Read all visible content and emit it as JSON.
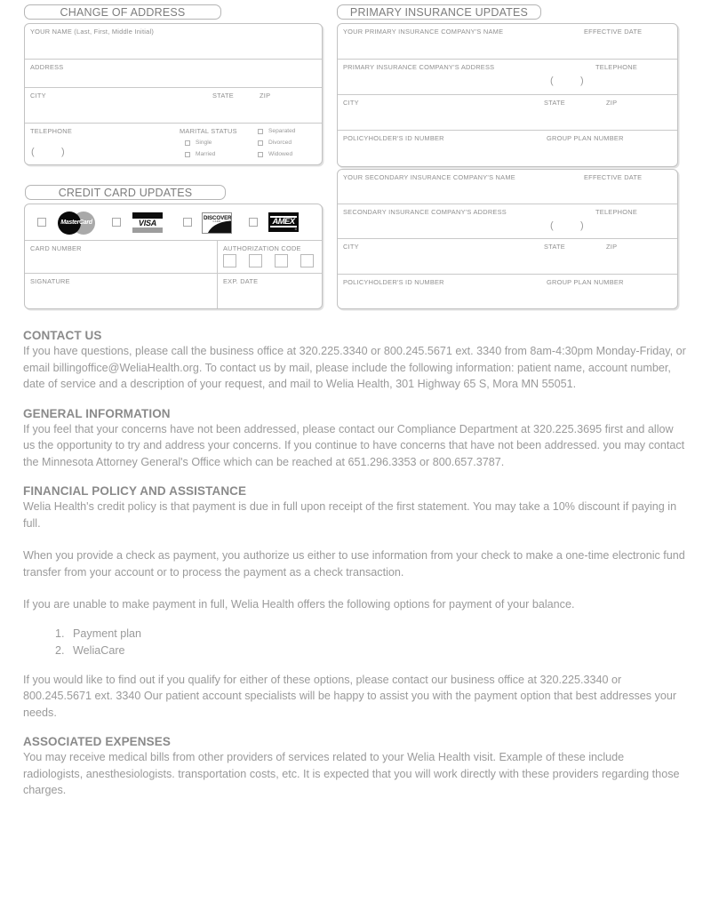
{
  "sections": {
    "change_of_address": {
      "title": "CHANGE OF ADDRESS",
      "fields": {
        "name": "YOUR NAME (Last, First, Middle Initial)",
        "address": "ADDRESS",
        "city": "CITY",
        "state": "STATE",
        "zip": "ZIP",
        "telephone": "TELEPHONE",
        "marital_status": "MARITAL STATUS",
        "phone_open": "(",
        "phone_close": ")"
      },
      "marital_options": [
        "Single",
        "Married",
        "Separated",
        "Divorced",
        "Widowed"
      ]
    },
    "credit_card_updates": {
      "title": "CREDIT CARD UPDATES",
      "cards": [
        {
          "name": "MasterCard",
          "label": "MasterCard"
        },
        {
          "name": "Visa",
          "label": "VISA"
        },
        {
          "name": "Discover",
          "label": "DISCOVER",
          "sub": "CARD"
        },
        {
          "name": "Amex",
          "label": "AMEX",
          "reg": "®"
        }
      ],
      "fields": {
        "card_number": "CARD NUMBER",
        "authorization_code": "AUTHORIZATION CODE",
        "signature": "SIGNATURE",
        "exp_date": "EXP. DATE"
      }
    },
    "primary_insurance": {
      "title": "PRIMARY INSURANCE UPDATES",
      "fields": {
        "company_name": "YOUR PRIMARY INSURANCE COMPANY'S NAME",
        "effective_date": "EFFECTIVE DATE",
        "company_address": "PRIMARY INSURANCE COMPANY'S ADDRESS",
        "telephone": "TELEPHONE",
        "city": "CITY",
        "state": "STATE",
        "zip": "ZIP",
        "policyholder_id": "POLICYHOLDER'S ID NUMBER",
        "group_plan": "GROUP PLAN NUMBER",
        "phone_open": "(",
        "phone_close": ")"
      }
    },
    "secondary_insurance": {
      "fields": {
        "company_name": "YOUR SECONDARY INSURANCE COMPANY'S NAME",
        "effective_date": "EFFECTIVE DATE",
        "company_address": "SECONDARY INSURANCE COMPANY'S ADDRESS",
        "telephone": "TELEPHONE",
        "city": "CITY",
        "state": "STATE",
        "zip": "ZIP",
        "policyholder_id": "POLICYHOLDER'S ID NUMBER",
        "group_plan": "GROUP PLAN NUMBER",
        "phone_open": "(",
        "phone_close": ")"
      }
    }
  },
  "contact_us": {
    "heading": "CONTACT US",
    "body": "If you have questions, please call the business office at 320.225.3340 or 800.245.5671 ext. 3340 from 8am-4:30pm Monday-Friday, or email billingoffice@WeliaHealth.org. To contact us by mail, please include the following information: patient name, account number, date of service and a description of your request, and mail to Welia Health, 301 Highway 65 S, Mora MN 55051."
  },
  "general_information": {
    "heading": "GENERAL INFORMATION",
    "body": "If you feel that your concerns have not been addressed, please contact our Compliance Department at 320.225.3695 first and allow us the opportunity to try and address your concerns. If you continue to have concerns that have not been addressed. you may contact the Minnesota Attorney General's Office which can be reached at 651.296.3353 or 800.657.3787."
  },
  "financial_policy": {
    "heading": "FINANCIAL POLICY AND ASSISTANCE",
    "paragraph1": "Welia Health's credit policy is that payment is due in full upon receipt of the first statement. You may take a 10% discount if paying in full.",
    "paragraph2": "When you provide a check as payment, you authorize us either to use information from your check to make a one-time electronic fund transfer from your account or to process the payment as a check transaction.",
    "paragraph3": "If you are unable to make payment in full, Welia Health offers the following options for payment of your balance.",
    "options": [
      "Payment plan",
      "WeliaCare"
    ],
    "paragraph4": "If you would like to find out if you qualify for either of these options, please contact our business office at 320.225.3340 or 800.245.5671 ext. 3340 Our patient account specialists will be happy to assist you with the payment option that best addresses your needs."
  },
  "associated_expenses": {
    "heading": "ASSOCIATED EXPENSES",
    "body": "You may receive medical bills from other providers of services related to your Welia Health visit. Example of these include radiologists, anesthesiologists. transportation costs, etc. It is expected that you will work directly with these providers regarding those charges."
  }
}
